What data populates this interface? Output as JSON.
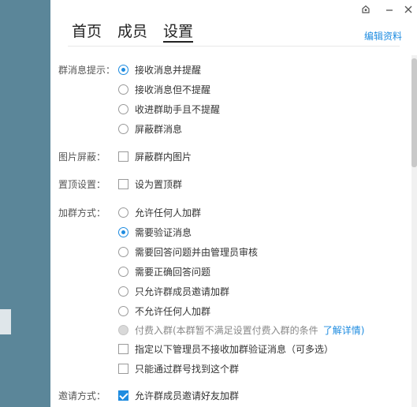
{
  "tabs": [
    "首页",
    "成员",
    "设置"
  ],
  "edit_profile": "编辑资料",
  "icons": {
    "skin": "skin-icon",
    "minimize": "minimize-icon",
    "close": "close-icon"
  },
  "colors": {
    "accent": "#1f8ce0",
    "sidebar": "#5b8699"
  },
  "msg": {
    "label": "群消息提示：",
    "options": [
      "接收消息并提醒",
      "接收消息但不提醒",
      "收进群助手且不提醒",
      "屏蔽群消息"
    ],
    "selected": 0
  },
  "image_block": {
    "label": "图片屏蔽：",
    "option": "屏蔽群内图片",
    "checked": false
  },
  "pin": {
    "label": "置顶设置：",
    "option": "设为置顶群",
    "checked": false
  },
  "join": {
    "label": "加群方式：",
    "options": [
      "允许任何人加群",
      "需要验证消息",
      "需要回答问题并由管理员审核",
      "需要正确回答问题",
      "只允许群成员邀请加群",
      "不允许任何人加群"
    ],
    "selected": 1,
    "paid": "付费入群(本群暂不满足设置付费入群的条件",
    "paid_link": "了解详情)",
    "check_admin": "指定以下管理员不接收加群验证消息（可多选）",
    "check_search": "只能通过群号找到这个群"
  },
  "invite": {
    "label": "邀请方式：",
    "option": "允许群成员邀请好友加群",
    "checked": true
  }
}
